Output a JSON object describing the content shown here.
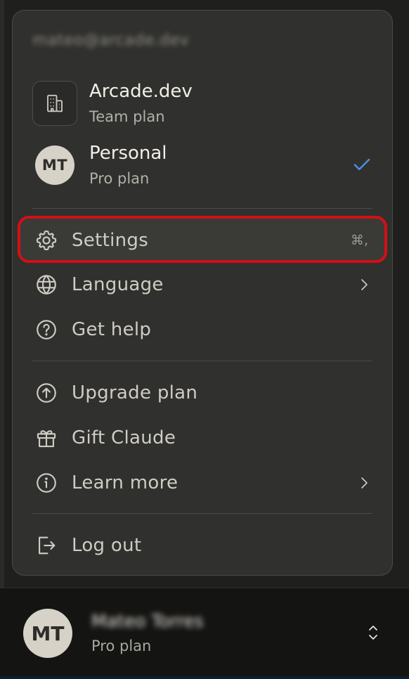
{
  "menu": {
    "email": "mateo@arcade.dev",
    "orgs": [
      {
        "name": "Arcade.dev",
        "plan": "Team plan",
        "icon": "building-icon"
      },
      {
        "name": "Personal",
        "plan": "Pro plan",
        "initials": "MT",
        "selected": true
      }
    ],
    "items": {
      "settings": {
        "label": "Settings",
        "shortcut": "⌘,",
        "icon": "gear-icon"
      },
      "language": {
        "label": "Language",
        "icon": "globe-icon"
      },
      "help": {
        "label": "Get help",
        "icon": "help-circle-icon"
      },
      "upgrade": {
        "label": "Upgrade plan",
        "icon": "arrow-up-circle-icon"
      },
      "gift": {
        "label": "Gift Claude",
        "icon": "gift-icon"
      },
      "learn": {
        "label": "Learn more",
        "icon": "info-icon"
      },
      "logout": {
        "label": "Log out",
        "icon": "logout-icon"
      }
    }
  },
  "account": {
    "initials": "MT",
    "name": "Mateo Torres",
    "plan": "Pro plan"
  },
  "colors": {
    "highlight": "#d40f16",
    "check": "#4a8fe0"
  }
}
